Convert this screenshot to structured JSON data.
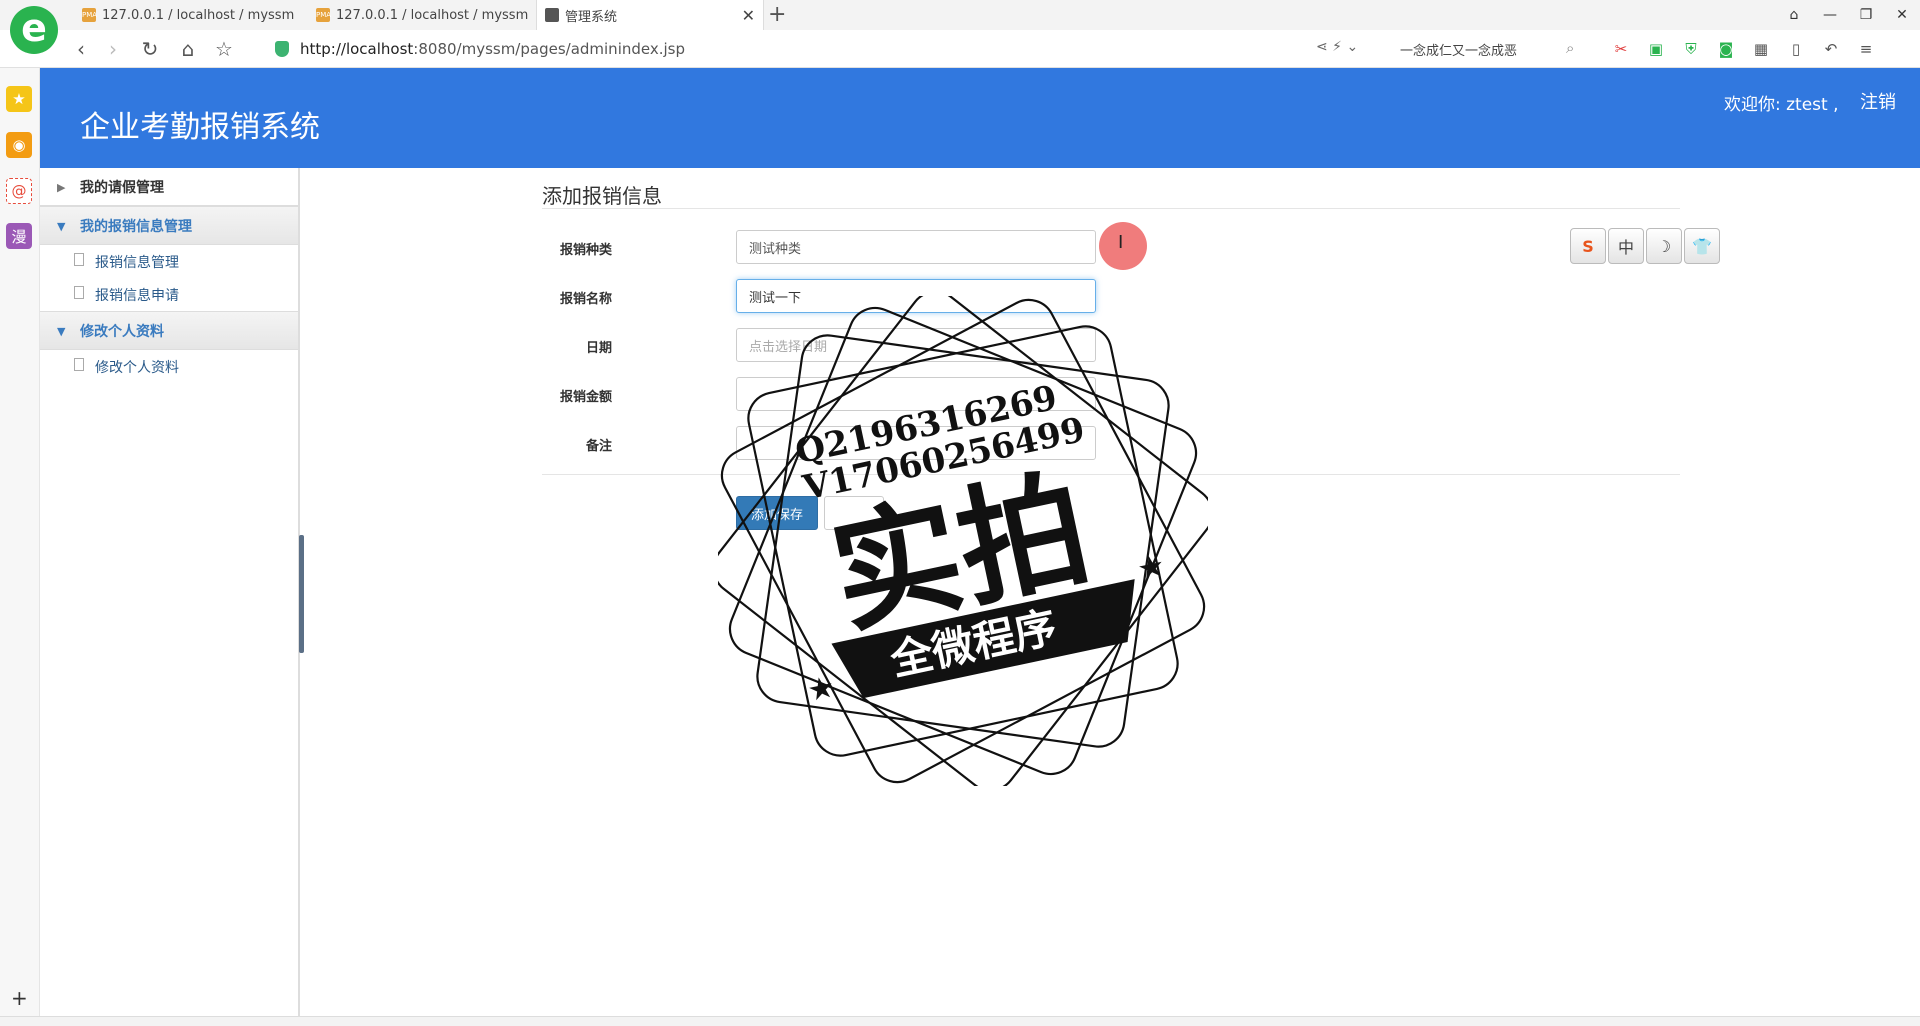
{
  "browser": {
    "logo_glyph": "e",
    "tabs": [
      {
        "label": "127.0.0.1 / localhost / myssm",
        "favicon": "PMA"
      },
      {
        "label": "127.0.0.1 / localhost / myssm",
        "favicon": "PMA"
      },
      {
        "label": "管理系统",
        "favicon": ""
      }
    ],
    "new_tab": "+",
    "url_host": "http://localhost",
    "url_rest": ":8080/myssm/pages/adminindex.jsp",
    "search_text": "一念成仁又一念成恶",
    "window_controls": [
      "⌂",
      "—",
      "❐",
      "✕"
    ]
  },
  "header": {
    "title": "企业考勤报销系统",
    "welcome": "欢迎你: ztest ,",
    "logout": "注销"
  },
  "sidebar": {
    "groups": [
      {
        "label": "我的请假管理",
        "open": false,
        "items": []
      },
      {
        "label": "我的报销信息管理",
        "open": true,
        "items": [
          "报销信息管理",
          "报销信息申请"
        ]
      },
      {
        "label": "修改个人资料",
        "open": true,
        "items": [
          "修改个人资料"
        ]
      }
    ]
  },
  "form": {
    "title": "添加报销信息",
    "fields": [
      {
        "label": "报销种类",
        "value": "测试种类",
        "placeholder": ""
      },
      {
        "label": "报销名称",
        "value": "测试一下",
        "placeholder": ""
      },
      {
        "label": "日期",
        "value": "",
        "placeholder": "点击选择日期"
      },
      {
        "label": "报销金额",
        "value": "",
        "placeholder": ""
      },
      {
        "label": "备注",
        "value": "",
        "placeholder": ""
      }
    ],
    "save_label": "添加保存"
  },
  "ime_toolbar": [
    "S",
    "中",
    "☽",
    "👕"
  ],
  "watermark": {
    "line1": "Q2196316269",
    "line2": "V17060256499",
    "big": "实拍",
    "banner": "全微程序"
  },
  "colors": {
    "header_bg": "#3178df",
    "accent": "#337ab7",
    "menu_active": "#3a7bbf"
  }
}
